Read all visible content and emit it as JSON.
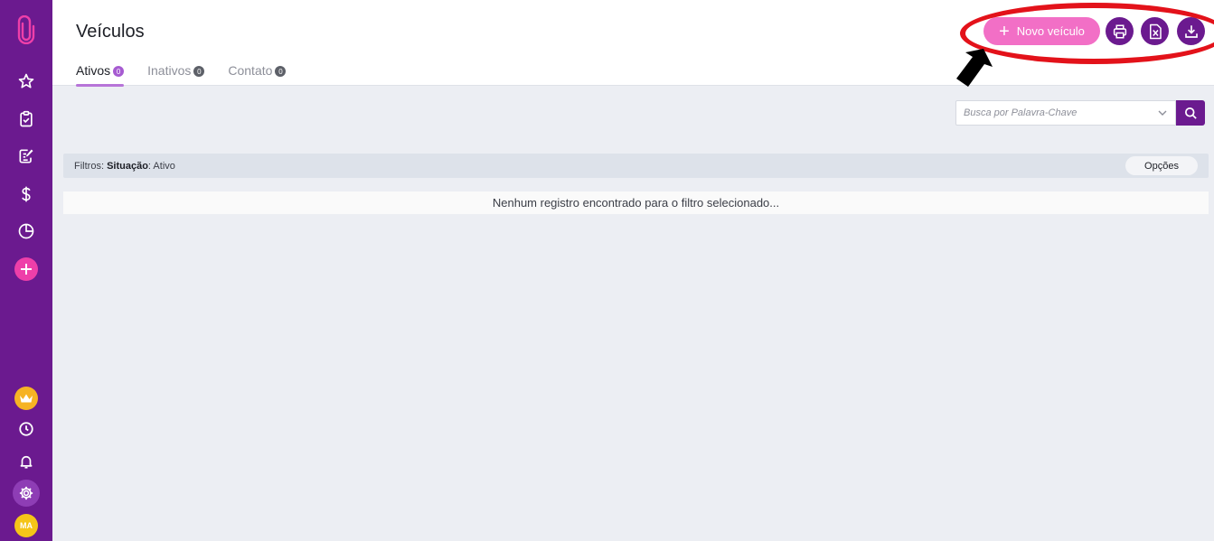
{
  "page": {
    "title": "Veículos"
  },
  "tabs": [
    {
      "label": "Ativos",
      "count": "0",
      "active": true
    },
    {
      "label": "Inativos",
      "count": "0",
      "active": false
    },
    {
      "label": "Contato",
      "count": "0",
      "active": false
    }
  ],
  "actions": {
    "new_label": "Novo veículo",
    "print_icon": "printer-icon",
    "excel_icon": "excel-file-icon",
    "download_icon": "download-icon"
  },
  "search": {
    "placeholder": "Busca por Palavra-Chave"
  },
  "filters": {
    "prefix": "Filtros:",
    "key": "Situação",
    "value": ": Ativo",
    "options_label": "Opções"
  },
  "empty_message": "Nenhum registro encontrado para o filtro selecionado...",
  "sidebar": {
    "avatar_initials": "MA",
    "icons": [
      "paperclip-logo-icon",
      "star-icon",
      "clipboard-check-icon",
      "edit-document-icon",
      "dollar-icon",
      "pie-chart-icon",
      "plus-icon",
      "crown-icon",
      "clock-icon",
      "bell-icon",
      "gear-icon"
    ]
  },
  "colors": {
    "sidebar": "#6b1a8f",
    "accent_pink": "#f26fc6",
    "annotation_red": "#e3121a"
  }
}
